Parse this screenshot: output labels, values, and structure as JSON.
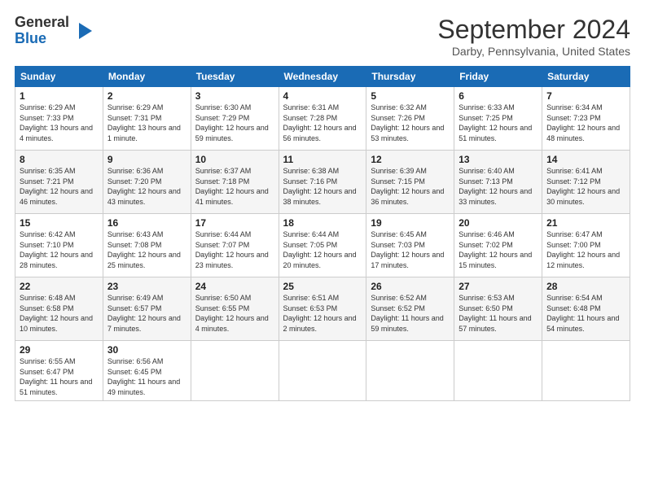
{
  "header": {
    "logo_general": "General",
    "logo_blue": "Blue",
    "month_title": "September 2024",
    "location": "Darby, Pennsylvania, United States"
  },
  "days_of_week": [
    "Sunday",
    "Monday",
    "Tuesday",
    "Wednesday",
    "Thursday",
    "Friday",
    "Saturday"
  ],
  "weeks": [
    [
      {
        "day": "1",
        "sunrise": "6:29 AM",
        "sunset": "7:33 PM",
        "daylight": "13 hours and 4 minutes."
      },
      {
        "day": "2",
        "sunrise": "6:29 AM",
        "sunset": "7:31 PM",
        "daylight": "13 hours and 1 minute."
      },
      {
        "day": "3",
        "sunrise": "6:30 AM",
        "sunset": "7:29 PM",
        "daylight": "12 hours and 59 minutes."
      },
      {
        "day": "4",
        "sunrise": "6:31 AM",
        "sunset": "7:28 PM",
        "daylight": "12 hours and 56 minutes."
      },
      {
        "day": "5",
        "sunrise": "6:32 AM",
        "sunset": "7:26 PM",
        "daylight": "12 hours and 53 minutes."
      },
      {
        "day": "6",
        "sunrise": "6:33 AM",
        "sunset": "7:25 PM",
        "daylight": "12 hours and 51 minutes."
      },
      {
        "day": "7",
        "sunrise": "6:34 AM",
        "sunset": "7:23 PM",
        "daylight": "12 hours and 48 minutes."
      }
    ],
    [
      {
        "day": "8",
        "sunrise": "6:35 AM",
        "sunset": "7:21 PM",
        "daylight": "12 hours and 46 minutes."
      },
      {
        "day": "9",
        "sunrise": "6:36 AM",
        "sunset": "7:20 PM",
        "daylight": "12 hours and 43 minutes."
      },
      {
        "day": "10",
        "sunrise": "6:37 AM",
        "sunset": "7:18 PM",
        "daylight": "12 hours and 41 minutes."
      },
      {
        "day": "11",
        "sunrise": "6:38 AM",
        "sunset": "7:16 PM",
        "daylight": "12 hours and 38 minutes."
      },
      {
        "day": "12",
        "sunrise": "6:39 AM",
        "sunset": "7:15 PM",
        "daylight": "12 hours and 36 minutes."
      },
      {
        "day": "13",
        "sunrise": "6:40 AM",
        "sunset": "7:13 PM",
        "daylight": "12 hours and 33 minutes."
      },
      {
        "day": "14",
        "sunrise": "6:41 AM",
        "sunset": "7:12 PM",
        "daylight": "12 hours and 30 minutes."
      }
    ],
    [
      {
        "day": "15",
        "sunrise": "6:42 AM",
        "sunset": "7:10 PM",
        "daylight": "12 hours and 28 minutes."
      },
      {
        "day": "16",
        "sunrise": "6:43 AM",
        "sunset": "7:08 PM",
        "daylight": "12 hours and 25 minutes."
      },
      {
        "day": "17",
        "sunrise": "6:44 AM",
        "sunset": "7:07 PM",
        "daylight": "12 hours and 23 minutes."
      },
      {
        "day": "18",
        "sunrise": "6:44 AM",
        "sunset": "7:05 PM",
        "daylight": "12 hours and 20 minutes."
      },
      {
        "day": "19",
        "sunrise": "6:45 AM",
        "sunset": "7:03 PM",
        "daylight": "12 hours and 17 minutes."
      },
      {
        "day": "20",
        "sunrise": "6:46 AM",
        "sunset": "7:02 PM",
        "daylight": "12 hours and 15 minutes."
      },
      {
        "day": "21",
        "sunrise": "6:47 AM",
        "sunset": "7:00 PM",
        "daylight": "12 hours and 12 minutes."
      }
    ],
    [
      {
        "day": "22",
        "sunrise": "6:48 AM",
        "sunset": "6:58 PM",
        "daylight": "12 hours and 10 minutes."
      },
      {
        "day": "23",
        "sunrise": "6:49 AM",
        "sunset": "6:57 PM",
        "daylight": "12 hours and 7 minutes."
      },
      {
        "day": "24",
        "sunrise": "6:50 AM",
        "sunset": "6:55 PM",
        "daylight": "12 hours and 4 minutes."
      },
      {
        "day": "25",
        "sunrise": "6:51 AM",
        "sunset": "6:53 PM",
        "daylight": "12 hours and 2 minutes."
      },
      {
        "day": "26",
        "sunrise": "6:52 AM",
        "sunset": "6:52 PM",
        "daylight": "11 hours and 59 minutes."
      },
      {
        "day": "27",
        "sunrise": "6:53 AM",
        "sunset": "6:50 PM",
        "daylight": "11 hours and 57 minutes."
      },
      {
        "day": "28",
        "sunrise": "6:54 AM",
        "sunset": "6:48 PM",
        "daylight": "11 hours and 54 minutes."
      }
    ],
    [
      {
        "day": "29",
        "sunrise": "6:55 AM",
        "sunset": "6:47 PM",
        "daylight": "11 hours and 51 minutes."
      },
      {
        "day": "30",
        "sunrise": "6:56 AM",
        "sunset": "6:45 PM",
        "daylight": "11 hours and 49 minutes."
      },
      null,
      null,
      null,
      null,
      null
    ]
  ]
}
